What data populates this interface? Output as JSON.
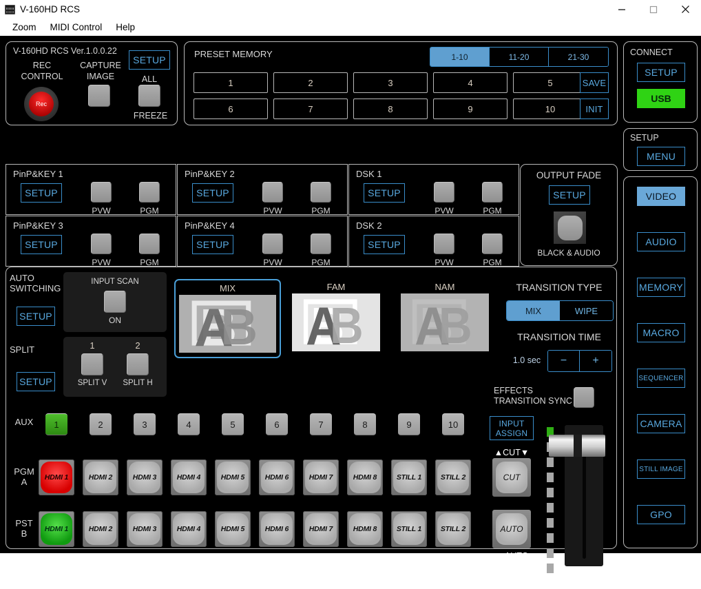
{
  "window": {
    "title": "V-160HD RCS",
    "icon": "mixer-icon",
    "minimize": "—",
    "maximize": "□",
    "close": "✕"
  },
  "menubar": {
    "items": [
      {
        "label": "Zoom",
        "name": "menu-zoom"
      },
      {
        "label": "MIDI Control",
        "name": "menu-midi-control"
      },
      {
        "label": "Help",
        "name": "menu-help"
      }
    ]
  },
  "rec_panel": {
    "version": "V-160HD RCS Ver.1.0.0.22",
    "rec_control_label": "REC\nCONTROL",
    "rec_control_line1": "REC",
    "rec_control_line2": "CONTROL",
    "capture_line1": "CAPTURE",
    "capture_line2": "IMAGE",
    "setup_label": "SETUP",
    "all_label": "ALL",
    "freeze_label": "FREEZE",
    "rec_button_label": "Rec",
    "rec_color": "#ff2b2b"
  },
  "preset_memory": {
    "title": "PRESET MEMORY",
    "tabs": [
      {
        "label": "1-10",
        "selected": true
      },
      {
        "label": "11-20",
        "selected": false
      },
      {
        "label": "21-30",
        "selected": false
      }
    ],
    "slots": [
      "1",
      "2",
      "3",
      "4",
      "5",
      "6",
      "7",
      "8",
      "9",
      "10"
    ],
    "save_label": "SAVE",
    "init_label": "INIT",
    "accent": "#5f9fd0"
  },
  "connect": {
    "title": "CONNECT",
    "setup_label": "SETUP",
    "usb_label": "USB",
    "usb_color": "#2fd314"
  },
  "setup_block": {
    "title": "SETUP",
    "menu_label": "MENU"
  },
  "nav": {
    "items": [
      {
        "label": "VIDEO",
        "selected": true,
        "small": false
      },
      {
        "label": "AUDIO",
        "selected": false,
        "small": false
      },
      {
        "label": "MEMORY",
        "selected": false,
        "small": false
      },
      {
        "label": "MACRO",
        "selected": false,
        "small": false
      },
      {
        "label": "SEQUENCER",
        "selected": false,
        "small": true
      },
      {
        "label": "CAMERA",
        "selected": false,
        "small": false
      },
      {
        "label": "STILL IMAGE",
        "selected": false,
        "small": true
      },
      {
        "label": "GPO",
        "selected": false,
        "small": false
      }
    ]
  },
  "keyers": [
    {
      "title": "PinP&KEY 1",
      "setup": "SETUP",
      "pvw": "PVW",
      "pgm": "PGM"
    },
    {
      "title": "PinP&KEY 2",
      "setup": "SETUP",
      "pvw": "PVW",
      "pgm": "PGM"
    },
    {
      "title": "DSK 1",
      "setup": "SETUP",
      "pvw": "PVW",
      "pgm": "PGM"
    },
    {
      "title": "PinP&KEY 3",
      "setup": "SETUP",
      "pvw": "PVW",
      "pgm": "PGM"
    },
    {
      "title": "PinP&KEY 4",
      "setup": "SETUP",
      "pvw": "PVW",
      "pgm": "PGM"
    },
    {
      "title": "DSK 2",
      "setup": "SETUP",
      "pvw": "PVW",
      "pgm": "PGM"
    }
  ],
  "output_fade": {
    "title": "OUTPUT FADE",
    "setup_label": "SETUP",
    "sub_label": "BLACK & AUDIO"
  },
  "auto_switching": {
    "label_line1": "AUTO",
    "label_line2": "SWITCHING",
    "setup_label": "SETUP",
    "scan_title": "INPUT SCAN",
    "scan_state": "ON"
  },
  "split": {
    "label": "SPLIT",
    "setup_label": "SETUP",
    "items": [
      {
        "num": "1",
        "sub": "SPLIT V"
      },
      {
        "num": "2",
        "sub": "SPLIT H"
      }
    ]
  },
  "transition_tiles": [
    {
      "label": "MIX",
      "selected": true,
      "bg": "#b0b0b0"
    },
    {
      "label": "FAM",
      "selected": false,
      "bg": "#e4e4e4"
    },
    {
      "label": "NAM",
      "selected": false,
      "bg": "#b3b3b3"
    }
  ],
  "transition": {
    "type_title": "TRANSITION TYPE",
    "types": [
      {
        "label": "MIX",
        "selected": true
      },
      {
        "label": "WIPE",
        "selected": false
      }
    ],
    "time_title": "TRANSITION TIME",
    "time_value": "1.0 sec",
    "minus": "−",
    "plus": "+",
    "effects_line1": "EFFECTS",
    "effects_line2": "TRANSITION SYNC"
  },
  "bus": {
    "aux_label": "AUX",
    "aux_items": [
      {
        "label": "1",
        "on": true
      },
      {
        "label": "2",
        "on": false
      },
      {
        "label": "3",
        "on": false
      },
      {
        "label": "4",
        "on": false
      },
      {
        "label": "5",
        "on": false
      },
      {
        "label": "6",
        "on": false
      },
      {
        "label": "7",
        "on": false
      },
      {
        "label": "8",
        "on": false
      },
      {
        "label": "9",
        "on": false
      },
      {
        "label": "10",
        "on": false
      }
    ],
    "pgm_label_line1": "PGM",
    "pgm_label_line2": "A",
    "pst_label_line1": "PST",
    "pst_label_line2": "B",
    "sources": [
      "HDMI 1",
      "HDMI 2",
      "HDMI 3",
      "HDMI 4",
      "HDMI 5",
      "HDMI 6",
      "HDMI 7",
      "HDMI 8",
      "STILL 1",
      "STILL 2"
    ],
    "pgm_active_index": 0,
    "pst_active_index": 0,
    "pgm_color": "#ff2b2b",
    "pst_color": "#2fae14"
  },
  "transport": {
    "input_assign_line1": "INPUT",
    "input_assign_line2": "ASSIGN",
    "cut_header": "▲CUT▼",
    "cut_label": "CUT",
    "auto_label": "AUTO",
    "auto_footer": "▲AUTO TAKE▼",
    "led_count": 10,
    "led_on_index": 0,
    "fader_position_percent": 2
  }
}
